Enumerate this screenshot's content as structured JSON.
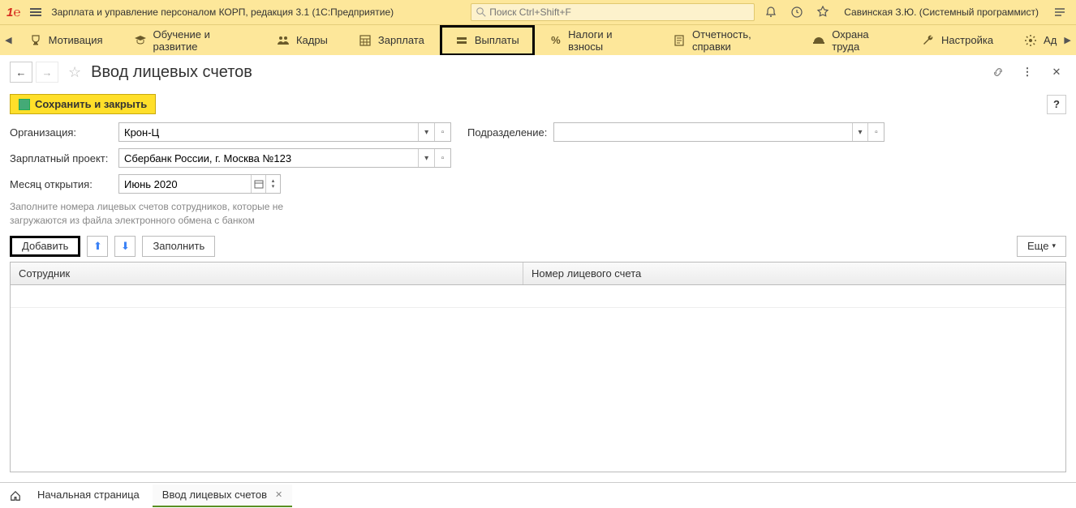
{
  "topbar": {
    "app_title": "Зарплата и управление персоналом КОРП, редакция 3.1  (1С:Предприятие)",
    "search_placeholder": "Поиск Ctrl+Shift+F",
    "user": "Савинская З.Ю. (Системный программист)"
  },
  "nav": {
    "items": [
      {
        "label": "Мотивация",
        "icon": "trophy"
      },
      {
        "label": "Обучение и развитие",
        "icon": "grad-cap"
      },
      {
        "label": "Кадры",
        "icon": "people"
      },
      {
        "label": "Зарплата",
        "icon": "calc"
      },
      {
        "label": "Выплаты",
        "icon": "wallet",
        "active": true
      },
      {
        "label": "Налоги и взносы",
        "icon": "percent"
      },
      {
        "label": "Отчетность, справки",
        "icon": "doc"
      },
      {
        "label": "Охрана труда",
        "icon": "helmet"
      },
      {
        "label": "Настройка",
        "icon": "wrench"
      },
      {
        "label": "Ад",
        "icon": "gear"
      }
    ]
  },
  "page": {
    "title": "Ввод лицевых счетов",
    "save_btn": "Сохранить и закрыть",
    "help": "?",
    "hint": "Заполните номера лицевых счетов сотрудников, которые не загружаются из файла электронного обмена с банком",
    "org_label": "Организация:",
    "org_value": "Крон-Ц",
    "dept_label": "Подразделение:",
    "dept_value": "",
    "proj_label": "Зарплатный проект:",
    "proj_value": "Сбербанк России, г. Москва №123",
    "month_label": "Месяц открытия:",
    "month_value": "Июнь 2020",
    "toolbar": {
      "add": "Добавить",
      "fill": "Заполнить",
      "more": "Еще"
    },
    "table": {
      "col1": "Сотрудник",
      "col2": "Номер лицевого счета"
    }
  },
  "footer": {
    "home": "Начальная страница",
    "tab": "Ввод лицевых счетов"
  }
}
